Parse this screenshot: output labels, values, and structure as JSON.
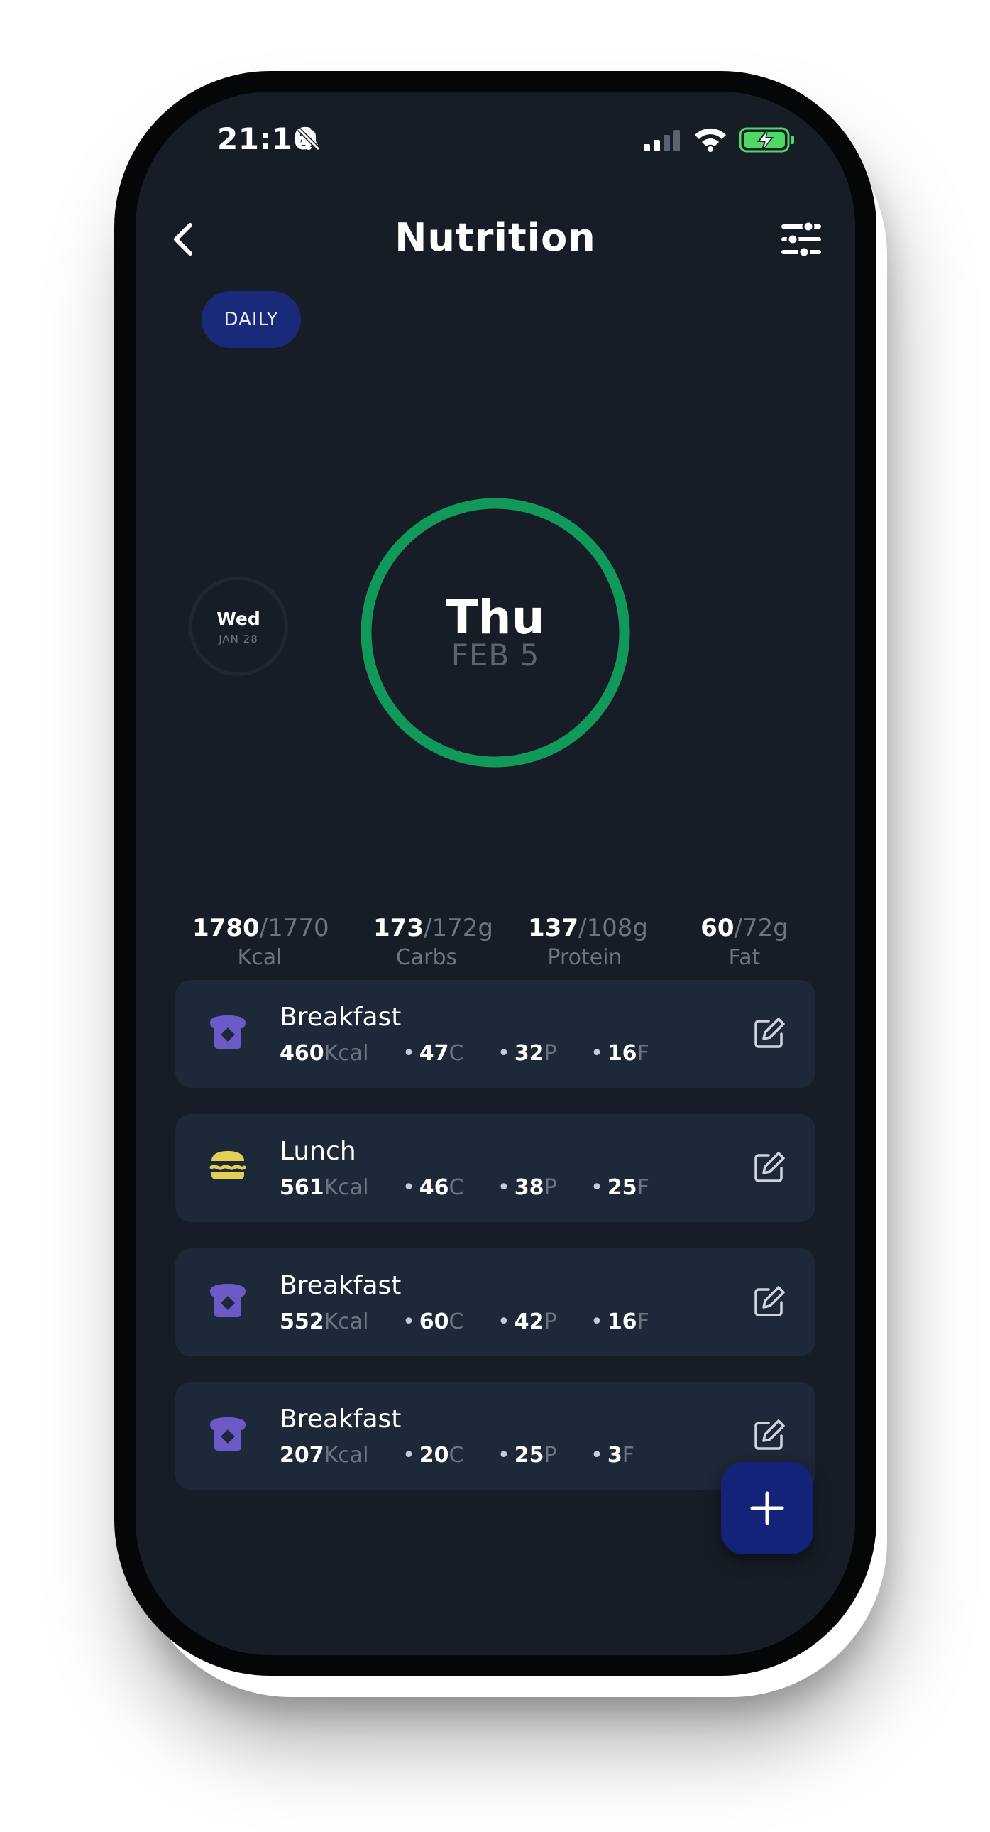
{
  "status_bar": {
    "time": "21:16"
  },
  "header": {
    "title": "Nutrition"
  },
  "view_toggle": {
    "label": "DAILY"
  },
  "date_selector": {
    "previous": {
      "day": "Wed",
      "date": "JAN 28"
    },
    "current": {
      "day": "Thu",
      "date": "FEB 5"
    },
    "ring_color": "#10995a"
  },
  "summary": [
    {
      "value": "1780",
      "goal": "/1770",
      "unit": "",
      "label": "Kcal"
    },
    {
      "value": "173",
      "goal": "/172",
      "unit": "g",
      "label": "Carbs"
    },
    {
      "value": "137",
      "goal": "/108",
      "unit": "g",
      "label": "Protein"
    },
    {
      "value": "60",
      "goal": "/72",
      "unit": "g",
      "label": "Fat"
    }
  ],
  "meals": [
    {
      "name": "Breakfast",
      "icon": "toast-icon",
      "kcal": "460",
      "kcal_unit": "Kcal",
      "carbs": "47",
      "c_unit": "C",
      "protein": "32",
      "p_unit": "P",
      "fat": "16",
      "f_unit": "F"
    },
    {
      "name": "Lunch",
      "icon": "burger-icon",
      "kcal": "561",
      "kcal_unit": "Kcal",
      "carbs": "46",
      "c_unit": "C",
      "protein": "38",
      "p_unit": "P",
      "fat": "25",
      "f_unit": "F"
    },
    {
      "name": "Breakfast",
      "icon": "toast-icon",
      "kcal": "552",
      "kcal_unit": "Kcal",
      "carbs": "60",
      "c_unit": "C",
      "protein": "42",
      "p_unit": "P",
      "fat": "16",
      "f_unit": "F"
    },
    {
      "name": "Breakfast",
      "icon": "toast-icon",
      "kcal": "207",
      "kcal_unit": "Kcal",
      "carbs": "20",
      "c_unit": "C",
      "protein": "25",
      "p_unit": "P",
      "fat": "3",
      "f_unit": "F"
    }
  ],
  "colors": {
    "background": "#171d27",
    "card": "#1d2838",
    "accent_blue": "#13237a",
    "breakfast_icon": "#6b5ac8",
    "lunch_icon": "#e3cf52",
    "battery": "#4cd964"
  }
}
